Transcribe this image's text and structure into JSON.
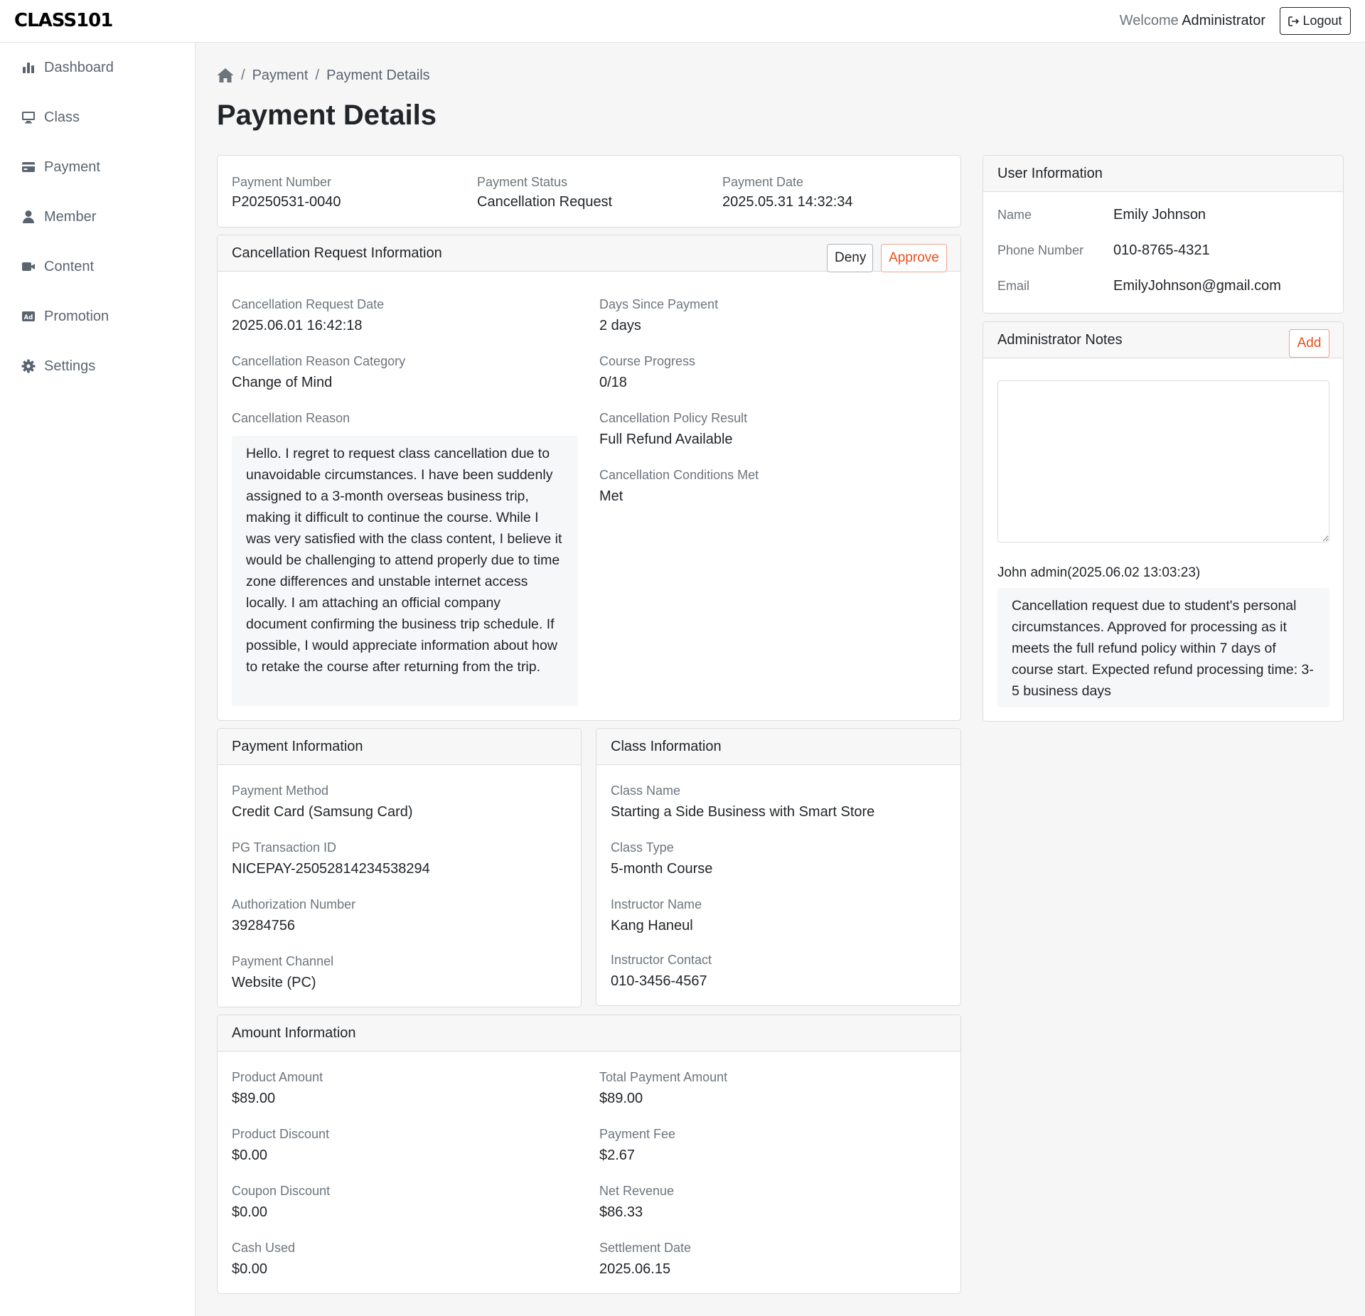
{
  "header": {
    "logo": "CLASS101",
    "welcome_prefix": "Welcome",
    "user": "Administrator",
    "logout_label": "Logout"
  },
  "sidebar": {
    "items": [
      {
        "label": "Dashboard",
        "icon": "bar-chart-icon"
      },
      {
        "label": "Class",
        "icon": "monitor-icon"
      },
      {
        "label": "Payment",
        "icon": "credit-card-icon"
      },
      {
        "label": "Member",
        "icon": "person-icon"
      },
      {
        "label": "Content",
        "icon": "video-camera-icon"
      },
      {
        "label": "Promotion",
        "icon": "ad-icon"
      },
      {
        "label": "Settings",
        "icon": "gear-icon"
      }
    ]
  },
  "breadcrumb": {
    "items": [
      "Payment",
      "Payment Details"
    ],
    "separator": "/"
  },
  "page_title": "Payment Details",
  "summary": {
    "payment_number_label": "Payment Number",
    "payment_number": "P20250531-0040",
    "payment_status_label": "Payment Status",
    "payment_status": "Cancellation Request",
    "payment_date_label": "Payment Date",
    "payment_date": "2025.05.31 14:32:34"
  },
  "cancellation": {
    "title": "Cancellation Request Information",
    "deny_label": "Deny",
    "approve_label": "Approve",
    "request_date_label": "Cancellation Request Date",
    "request_date": "2025.06.01 16:42:18",
    "reason_category_label": "Cancellation Reason Category",
    "reason_category": "Change of Mind",
    "reason_label": "Cancellation Reason",
    "reason_text": "Hello. I regret to request class cancellation due to unavoidable circumstances. I have been suddenly assigned to a 3-month overseas business trip, making it difficult to continue the course. While I was very satisfied with the class content, I believe it would be challenging to attend properly due to time zone differences and unstable internet access locally. I am attaching an official company document confirming the business trip schedule. If possible, I would appreciate information about how to retake the course after returning from the trip.",
    "days_since_label": "Days Since Payment",
    "days_since": "2 days",
    "progress_label": "Course Progress",
    "progress": "0/18",
    "policy_result_label": "Cancellation Policy Result",
    "policy_result": "Full Refund Available",
    "conditions_label": "Cancellation Conditions Met",
    "conditions": "Met"
  },
  "payment_info": {
    "title": "Payment Information",
    "method_label": "Payment Method",
    "method": "Credit Card (Samsung Card)",
    "pg_label": "PG Transaction ID",
    "pg": "NICEPAY-25052814234538294",
    "auth_label": "Authorization Number",
    "auth": "39284756",
    "channel_label": "Payment Channel",
    "channel": "Website (PC)"
  },
  "class_info": {
    "title": "Class Information",
    "name_label": "Class Name",
    "name": "Starting a Side Business with Smart Store",
    "type_label": "Class Type",
    "type": "5-month Course",
    "instructor_label": "Instructor Name",
    "instructor": "Kang Haneul",
    "contact_label": "Instructor Contact",
    "contact": "010-3456-4567"
  },
  "amount_info": {
    "title": "Amount Information",
    "product_amount_label": "Product Amount",
    "product_amount": "$89.00",
    "product_discount_label": "Product Discount",
    "product_discount": "$0.00",
    "coupon_discount_label": "Coupon Discount",
    "coupon_discount": "$0.00",
    "cash_used_label": "Cash Used",
    "cash_used": "$0.00",
    "total_label": "Total Payment Amount",
    "total": "$89.00",
    "fee_label": "Payment Fee",
    "fee": "$2.67",
    "net_label": "Net Revenue",
    "net": "$86.33",
    "settlement_label": "Settlement Date",
    "settlement": "2025.06.15"
  },
  "user_info": {
    "title": "User Information",
    "name_label": "Name",
    "name": "Emily Johnson",
    "phone_label": "Phone Number",
    "phone": "010-8765-4321",
    "email_label": "Email",
    "email": "EmilyJohnson@gmail.com"
  },
  "admin_notes": {
    "title": "Administrator Notes",
    "add_label": "Add",
    "textarea_value": "",
    "note_author": "John admin(2025.06.02 13:03:23)",
    "note_text": "Cancellation request due to student's personal circumstances. Approved for processing as it meets the full refund policy within 7 days of course start. Expected refund processing time: 3-5 business days"
  },
  "colors": {
    "accent": "#e8501c",
    "background": "#f6f6f6",
    "border": "#dcdcdc",
    "muted_text": "#6c757d"
  }
}
